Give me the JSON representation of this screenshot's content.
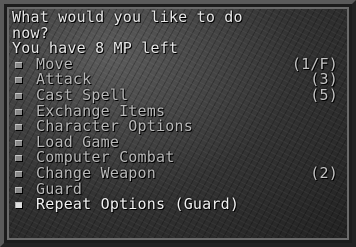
{
  "prompt": {
    "line1": "What would you like to do",
    "line2": "now?",
    "mp_line": "You have 8 MP left"
  },
  "menu": {
    "items": [
      {
        "label": "Move",
        "value": "(1/F)"
      },
      {
        "label": "Attack",
        "value": "(3)"
      },
      {
        "label": "Cast Spell",
        "value": "(5)"
      },
      {
        "label": "Exchange Items",
        "value": ""
      },
      {
        "label": "Character Options",
        "value": ""
      },
      {
        "label": "Load Game",
        "value": ""
      },
      {
        "label": "Computer Combat",
        "value": ""
      },
      {
        "label": "Change Weapon",
        "value": "(2)"
      },
      {
        "label": "Guard",
        "value": ""
      },
      {
        "label": "Repeat Options (Guard)",
        "value": ""
      }
    ]
  }
}
